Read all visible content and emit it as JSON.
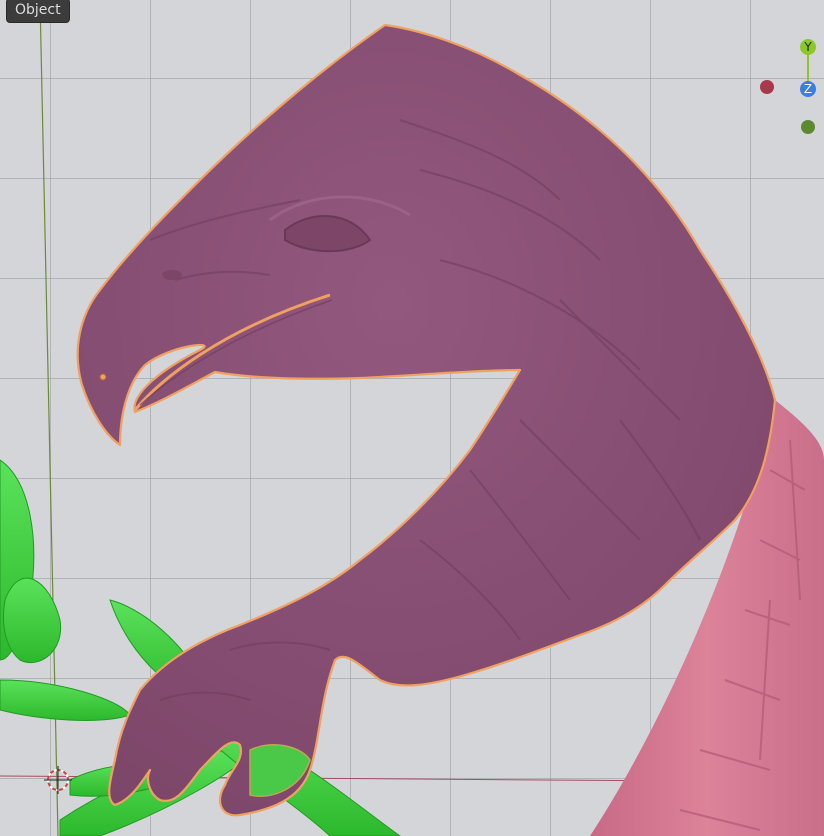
{
  "header": {
    "mode_label": "Object"
  },
  "gizmo": {
    "y_label": "Y",
    "z_label": "Z",
    "y_color": "#8ac926",
    "z_color": "#3a7fe0",
    "x_color": "#a8384a",
    "neg_color": "#5d8a2e"
  },
  "colors": {
    "grid_background": "#d3d5d8",
    "eagle_fill": "#8a5076",
    "selection_outline": "#f0a060",
    "leaf_fill": "#3ccf3c",
    "slab_fill": "#d87a94"
  },
  "icons": {
    "origin": "3d-cursor-icon"
  }
}
